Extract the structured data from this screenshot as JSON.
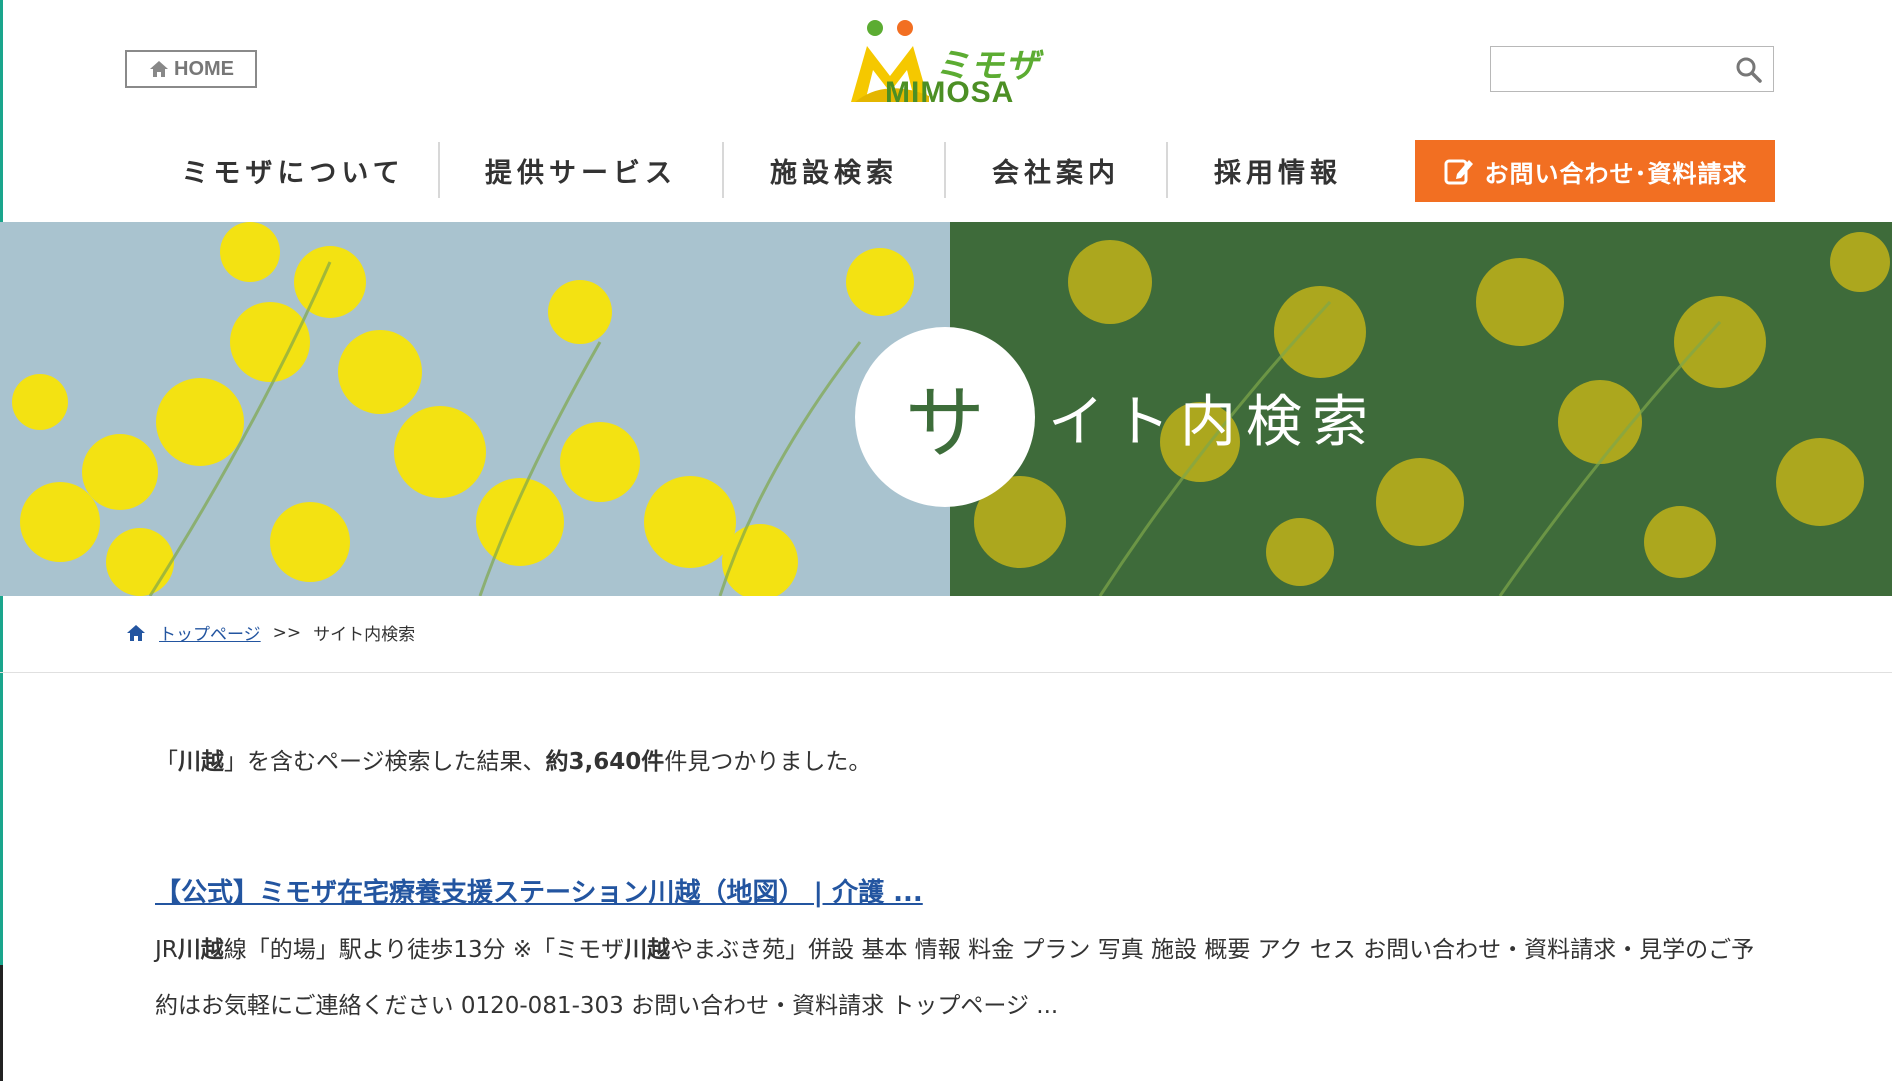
{
  "header": {
    "home_label": "HOME",
    "logo_jp": "ミモザ",
    "logo_en": "MIMOSA",
    "search": {
      "value": "",
      "placeholder": ""
    }
  },
  "nav": {
    "items": [
      "ミモザについて",
      "提供サービス",
      "施設検索",
      "会社案内",
      "採用情報"
    ],
    "contact_label": "お問い合わせ･資料請求"
  },
  "hero": {
    "first_char": "サ",
    "rest_title": "イト内検索"
  },
  "breadcrumb": {
    "home_link": "トップページ",
    "separator": ">>",
    "current": "サイト内検索"
  },
  "results": {
    "summary_prefix": "「",
    "keyword": "川越",
    "summary_mid": "」を含むページ検索した結果、",
    "count": "約3,640件",
    "summary_suffix": "件見つかりました。",
    "items": [
      {
        "title": "【公式】ミモザ在宅療養支援ステーション川越（地図） | 介護 ...",
        "snippet_parts": [
          {
            "text": "JR",
            "bold": false
          },
          {
            "text": "川越",
            "bold": true
          },
          {
            "text": "線「的場」駅より徒歩13分 ※「ミモザ",
            "bold": false
          },
          {
            "text": "川越",
            "bold": true
          },
          {
            "text": "やまぶき苑」併設 基本 情報 料金 プラン 写真 施設 概要 アク セス お問い合わせ・資料請求・見学のご予約はお気軽にご連絡ください 0120-081-303 お問い合わせ・資料請求 トップページ ...",
            "bold": false
          }
        ]
      }
    ]
  },
  "colors": {
    "accent_orange": "#f26f22",
    "link_blue": "#2355a0",
    "logo_green": "#5cac32",
    "hero_green": "#3e6b3a"
  }
}
